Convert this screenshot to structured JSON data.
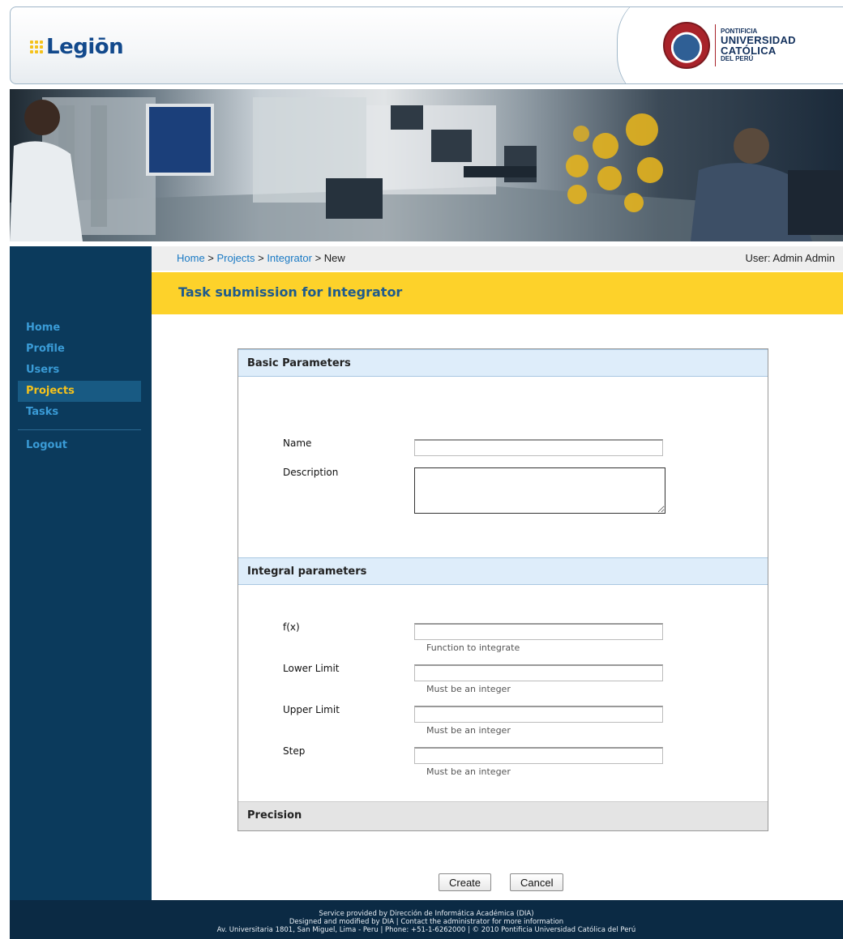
{
  "header": {
    "logo_text": "Legiōn",
    "university": {
      "line1": "PONTIFICIA",
      "line2": "UNIVERSIDAD",
      "line3": "CATÓLICA",
      "line4": "DEL PERÚ"
    }
  },
  "colors": {
    "sidebar_bg": "#0b3a5c",
    "nav_link": "#3a9bd6",
    "nav_active": "#f5c21b",
    "title_bar": "#fdd22a",
    "section_head": "#deedfa",
    "link": "#1a7ac4"
  },
  "breadcrumb": {
    "home": "Home",
    "sep1": " > ",
    "projects": "Projects",
    "sep2": " > ",
    "integrator": "Integrator",
    "sep3": " > ",
    "current": "New"
  },
  "user_label": "User: Admin Admin",
  "page_title": "Task submission for Integrator",
  "sidebar": {
    "items": [
      {
        "label": "Home",
        "active": false
      },
      {
        "label": "Profile",
        "active": false
      },
      {
        "label": "Users",
        "active": false
      },
      {
        "label": "Projects",
        "active": true
      },
      {
        "label": "Tasks",
        "active": false
      }
    ],
    "logout": "Logout"
  },
  "form": {
    "basic": {
      "title": "Basic Parameters",
      "name_label": "Name",
      "name_value": "",
      "description_label": "Description",
      "description_value": ""
    },
    "integral": {
      "title": "Integral parameters",
      "fx_label": "f(x)",
      "fx_value": "",
      "fx_hint": "Function to integrate",
      "lower_label": "Lower Limit",
      "lower_value": "",
      "lower_hint": "Must be an integer",
      "upper_label": "Upper Limit",
      "upper_value": "",
      "upper_hint": "Must be an integer",
      "step_label": "Step",
      "step_value": "",
      "step_hint": "Must be an integer"
    },
    "precision": {
      "title": "Precision"
    }
  },
  "buttons": {
    "create": "Create",
    "cancel": "Cancel"
  },
  "footer": {
    "line1": "Service provided by Dirección de Informática Académica (DIA)",
    "line2": "Designed and modified by DIA | Contact the administrator for more information",
    "line3": "Av. Universitaria 1801, San Miguel, Lima - Peru | Phone: +51-1-6262000 | © 2010 Pontificia Universidad Católica del Perú"
  }
}
